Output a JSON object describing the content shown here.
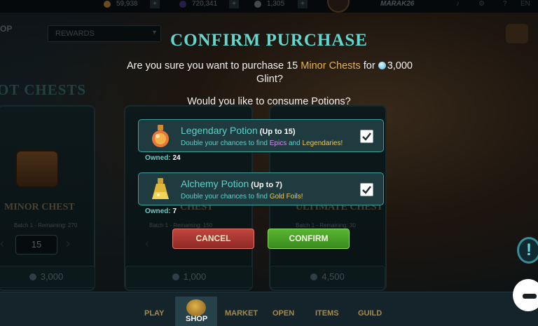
{
  "topbar": {
    "credits": "59,938",
    "dec": "720,341",
    "vouchers": "1,305",
    "plus": "+",
    "username": "MARAK26",
    "help": "?",
    "language": "EN"
  },
  "nav": {
    "shop_label": "OP",
    "filter_select": "REWARDS",
    "filter_arrow": "▾"
  },
  "background": {
    "section_title": "OT CHESTS",
    "cards": [
      {
        "name": "MINOR CHEST",
        "batch": "Batch 1 - Remaining: 270",
        "quantity": "15",
        "price": "3,000"
      },
      {
        "name": "CHEST",
        "batch": "Batch 1 - Remaining: 150",
        "price": "1,000"
      },
      {
        "name": "ULTIMATE CHEST",
        "batch": "Batch 1 - Remaining: 30",
        "price": "4,500"
      }
    ]
  },
  "modal": {
    "title": "CONFIRM PURCHASE",
    "question_prefix": "Are you sure you want to purchase 15 ",
    "item": "Minor Chests",
    "question_mid": " for ",
    "amount": "3,000",
    "currency": "Glint?",
    "potion_question": "Would you like to consume Potions?",
    "potions": [
      {
        "name": "Legendary Potion",
        "limit": "(Up to 15)",
        "desc_prefix": "Double your chances to find ",
        "desc_hl1": "Epics",
        "desc_mid": " and ",
        "desc_hl2": "Legendaries!",
        "owned_label": "Owned:",
        "owned": "24",
        "checked": true
      },
      {
        "name": "Alchemy Potion",
        "limit": "(Up to 7)",
        "desc_prefix": "Double your chances to find ",
        "desc_hl1": "Gold Foils!",
        "owned_label": "Owned:",
        "owned": "7",
        "checked": true
      }
    ],
    "cancel": "CANCEL",
    "confirm": "CONFIRM"
  },
  "bottom_nav": {
    "items": [
      "PLAY",
      "SHOP",
      "MARKET",
      "OPEN",
      "ITEMS",
      "GUILD"
    ],
    "active": "SHOP"
  },
  "side_alert": "!",
  "icons": {
    "legendary_potion": "legendary-potion-icon",
    "alchemy_potion": "alchemy-potion-icon",
    "glint": "glint-gem-icon",
    "checkbox": "check-icon"
  },
  "colors": {
    "accent_teal": "#5ed1cc",
    "title_teal": "#63d6cf",
    "highlight_gold": "#e9b04b",
    "cancel_red": "#c0453d",
    "confirm_green": "#58b631"
  }
}
